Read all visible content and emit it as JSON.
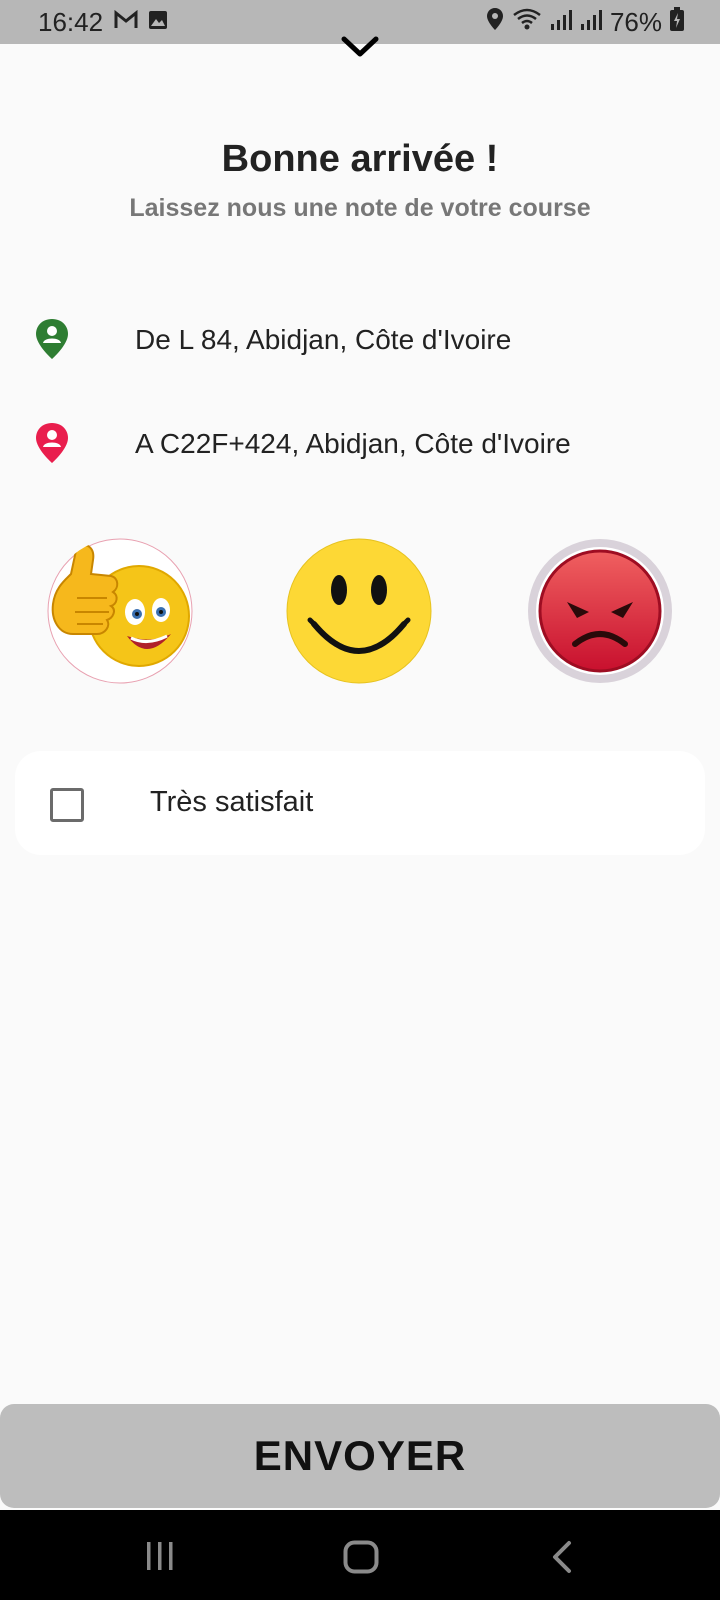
{
  "status_bar": {
    "time": "16:42",
    "battery": "76%",
    "left_icons": [
      "gmail-icon",
      "image-icon"
    ],
    "right_icons": [
      "location-icon",
      "wifi-icon",
      "signal-icon",
      "signal-icon",
      "battery-charging-icon"
    ]
  },
  "header": {
    "title": "Bonne arrivée !",
    "subtitle": "Laissez nous une note de votre course"
  },
  "route": {
    "origin": "De L 84, Abidjan, Côte d'Ivoire",
    "destination": "A C22F+424, Abidjan, Côte d'Ivoire",
    "origin_color": "#2e7d32",
    "destination_color": "#e91e4d"
  },
  "rating": {
    "options": [
      "thumbs-up-emoji",
      "smiley-emoji",
      "angry-emoji"
    ]
  },
  "satisfaction": {
    "label": "Très satisfait",
    "checked": false
  },
  "submit": {
    "label": "ENVOYER"
  },
  "nav": {
    "buttons": [
      "recent-apps-icon",
      "home-icon",
      "back-icon"
    ]
  }
}
